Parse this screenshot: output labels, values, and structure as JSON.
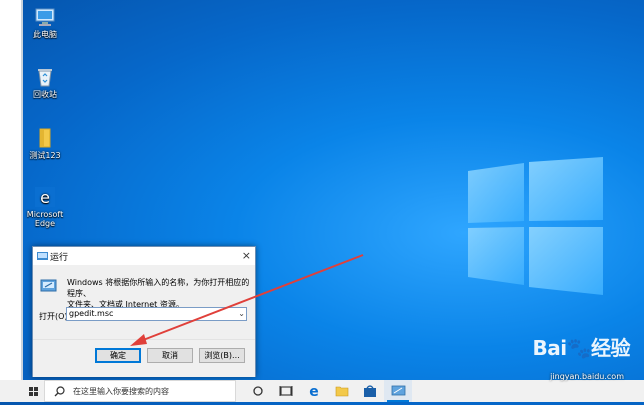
{
  "desktop": {
    "icons": [
      {
        "label": "此电脑"
      },
      {
        "label": "回收站"
      },
      {
        "label": "测试123"
      },
      {
        "label": "Microsoft Edge"
      }
    ]
  },
  "run_dialog": {
    "title": "运行",
    "close_glyph": "×",
    "description_line1": "Windows 将根据你所输入的名称，为你打开相应的程序、",
    "description_line2": "文件夹、文档或 Internet 资源。",
    "open_label": "打开(O):",
    "open_value": "gpedit.msc",
    "ok_label": "确定",
    "cancel_label": "取消",
    "browse_label": "浏览(B)..."
  },
  "taskbar": {
    "search_placeholder": "在这里输入你要搜索的内容"
  },
  "watermark": {
    "brand": "Bai🐾经验",
    "url": "jingyan.baidu.com"
  },
  "colors": {
    "accent": "#0078d7",
    "arrow": "#e0403a"
  }
}
